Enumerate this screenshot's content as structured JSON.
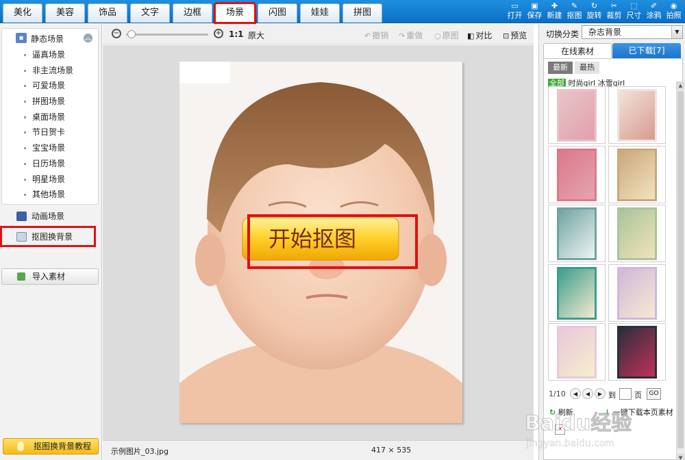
{
  "tabs": [
    "美化",
    "美容",
    "饰品",
    "文字",
    "边框",
    "场景",
    "闪图",
    "娃娃",
    "拼图"
  ],
  "toolbar": [
    {
      "icon": "folder-open-icon",
      "label": "打开"
    },
    {
      "icon": "save-icon",
      "label": "保存"
    },
    {
      "icon": "plus-icon",
      "label": "新建"
    },
    {
      "icon": "cutout-pen-icon",
      "label": "抠图"
    },
    {
      "icon": "rotate-icon",
      "label": "旋转"
    },
    {
      "icon": "scissors-icon",
      "label": "裁剪"
    },
    {
      "icon": "resize-icon",
      "label": "尺寸"
    },
    {
      "icon": "paint-icon",
      "label": "涂鸦"
    },
    {
      "icon": "camera-icon",
      "label": "拍照"
    }
  ],
  "sidebar": {
    "static_header": "静态场景",
    "items": [
      "逼真场景",
      "非主流场景",
      "可爱场景",
      "拼图场景",
      "桌面场景",
      "节日贺卡",
      "宝宝场景",
      "日历场景",
      "明星场景",
      "其他场景"
    ],
    "animated": "动画场景",
    "cutout_bg": "抠图换背景",
    "import": "导入素材",
    "tutorial": "抠图换背景教程"
  },
  "canvas": {
    "zoom_ratio": "1:1",
    "original_size": "原大",
    "actions": [
      {
        "icon": "undo-icon",
        "label": "撤销",
        "enabled": false
      },
      {
        "icon": "redo-icon",
        "label": "重做",
        "enabled": false
      },
      {
        "icon": "original-icon",
        "label": "原图",
        "enabled": false
      },
      {
        "icon": "compare-icon",
        "label": "对比",
        "enabled": true
      },
      {
        "icon": "preview-icon",
        "label": "预览",
        "enabled": true
      }
    ],
    "start_button": "开始抠图",
    "filename": "示例图片_03.jpg",
    "dimensions": "417 × 535"
  },
  "right": {
    "switch_label": "切换分类",
    "category": "杂志背景",
    "tab_online": "在线素材",
    "tab_downloaded": "已下载[7]",
    "sort_new": "最新",
    "sort_hot": "最热",
    "filter_all": "全部",
    "filter_1": "时尚girl",
    "filter_2": "冰雪girl",
    "page": "1/10",
    "to": "到",
    "page_unit": "页",
    "go": "GO",
    "refresh": "刷新",
    "download_more": "一键下载本页素材",
    "thumbnails": [
      {
        "bg": "#e9c4c9",
        "inner": "#e2a0ab"
      },
      {
        "bg": "#f0e4da",
        "inner": "#d99a8e"
      },
      {
        "bg": "#d97a8a",
        "inner": "#e7a3b0"
      },
      {
        "bg": "#caa77b",
        "inner": "#f2e3c0"
      },
      {
        "bg": "#6fa3a0",
        "inner": "#eef4f2"
      },
      {
        "bg": "#a9c49a",
        "inner": "#f2e2b8"
      },
      {
        "bg": "#3c9e8c",
        "inner": "#f4ead0"
      },
      {
        "bg": "#d0b7d9",
        "inner": "#f6ead0"
      },
      {
        "bg": "#e9c7dd",
        "inner": "#f7eecc"
      },
      {
        "bg": "#2a2e3a",
        "inner": "#c2315a"
      }
    ]
  },
  "watermark": "Baidu经验",
  "watermark_url": "jingyan.baidu.com"
}
